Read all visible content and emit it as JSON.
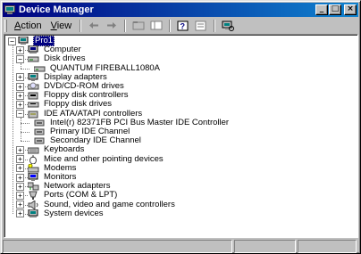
{
  "window": {
    "title": "Device Manager"
  },
  "titlebar_buttons": {
    "minimize": "_",
    "maximize": "□",
    "close": "×"
  },
  "menu": [
    {
      "label": "Action",
      "underline": "A"
    },
    {
      "label": "View",
      "underline": "V"
    }
  ],
  "tree": {
    "root": "Pro1",
    "items": [
      {
        "label": "Computer",
        "icon": "computer-icon",
        "expanded": false,
        "children": []
      },
      {
        "label": "Disk drives",
        "icon": "disk-drive-icon",
        "expanded": true,
        "children": [
          "QUANTUM FIREBALL1080A"
        ]
      },
      {
        "label": "Display adapters",
        "icon": "display-icon",
        "expanded": false,
        "children": []
      },
      {
        "label": "DVD/CD-ROM drives",
        "icon": "cdrom-icon",
        "expanded": false,
        "children": []
      },
      {
        "label": "Floppy disk controllers",
        "icon": "controller-icon",
        "expanded": false,
        "children": []
      },
      {
        "label": "Floppy disk drives",
        "icon": "floppy-icon",
        "expanded": false,
        "children": []
      },
      {
        "label": "IDE ATA/ATAPI controllers",
        "icon": "ide-controller-icon",
        "expanded": true,
        "children": [
          "Intel(r) 82371FB PCI Bus Master IDE Controller",
          "Primary IDE Channel",
          "Secondary IDE Channel"
        ]
      },
      {
        "label": "Keyboards",
        "icon": "keyboard-icon",
        "expanded": false,
        "children": []
      },
      {
        "label": "Mice and other pointing devices",
        "icon": "mouse-icon",
        "expanded": false,
        "children": []
      },
      {
        "label": "Modems",
        "icon": "modem-icon",
        "expanded": false,
        "children": []
      },
      {
        "label": "Monitors",
        "icon": "monitor-icon",
        "expanded": false,
        "children": []
      },
      {
        "label": "Network adapters",
        "icon": "network-icon",
        "expanded": false,
        "children": []
      },
      {
        "label": "Ports (COM & LPT)",
        "icon": "port-icon",
        "expanded": false,
        "children": []
      },
      {
        "label": "Sound, video and game controllers",
        "icon": "sound-icon",
        "expanded": false,
        "children": []
      },
      {
        "label": "System devices",
        "icon": "system-icon",
        "expanded": false,
        "children": []
      }
    ]
  },
  "colors": {
    "titlebar_start": "#000080",
    "titlebar_end": "#1084d0",
    "selection": "#000080",
    "face": "#c0c0c0"
  }
}
